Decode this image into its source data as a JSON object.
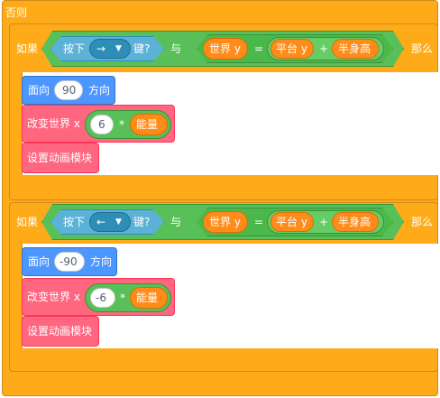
{
  "else_label": "否则",
  "blocks": [
    {
      "if_label": "如果",
      "key_pressed_prefix": "按下",
      "key": "→",
      "key_pressed_suffix": "键?",
      "and_label": "与",
      "var_world_y": "世界 y",
      "equals": "=",
      "var_platform_y": "平台 y",
      "plus": "+",
      "var_half_height": "半身高",
      "then_label": "那么",
      "point_prefix": "面向",
      "direction": "90",
      "point_suffix": "方向",
      "change_label": "改变世界 x",
      "speed_factor": "6",
      "times": "*",
      "var_energy": "能量",
      "anim_label": "设置动画模块"
    },
    {
      "if_label": "如果",
      "key_pressed_prefix": "按下",
      "key": "←",
      "key_pressed_suffix": "键?",
      "and_label": "与",
      "var_world_y": "世界 y",
      "equals": "=",
      "var_platform_y": "平台 y",
      "plus": "+",
      "var_half_height": "半身高",
      "then_label": "那么",
      "point_prefix": "面向",
      "direction": "-90",
      "point_suffix": "方向",
      "change_label": "改变世界 x",
      "speed_factor": "-6",
      "times": "*",
      "var_energy": "能量",
      "anim_label": "设置动画模块"
    }
  ],
  "colors": {
    "control": "#ffab19",
    "motion": "#4c97ff",
    "pen": "#ff6680",
    "operators": "#59c059",
    "sensing": "#5cb1d6",
    "variables": "#ff8c1a"
  },
  "icons": {
    "dropdown": "triangle-down-icon"
  }
}
